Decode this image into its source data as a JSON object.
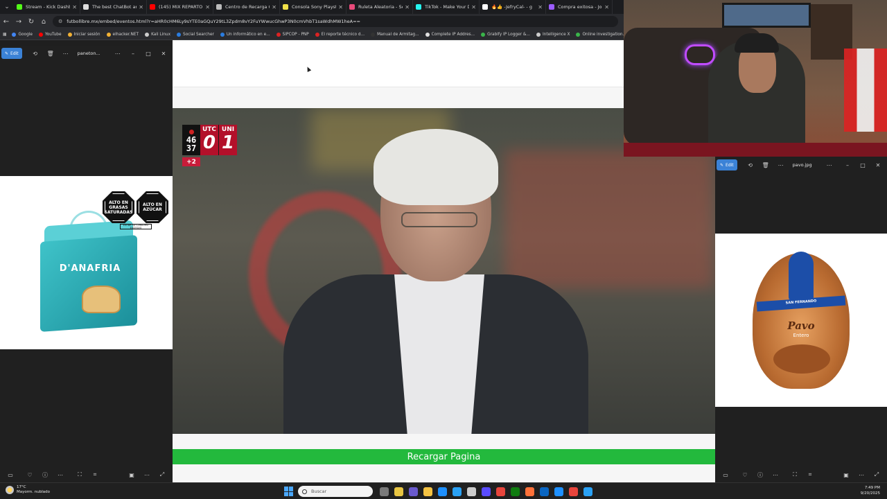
{
  "browser": {
    "tabs": [
      {
        "title": "Stream - Kick Dashboard",
        "color": "#53fc18"
      },
      {
        "title": "The best ChatBot and",
        "color": "#dddddd"
      },
      {
        "title": "(145) MIX REPARTO 20",
        "color": "#ff0000"
      },
      {
        "title": "Centro de Recarga Ga",
        "color": "#bbbbbb"
      },
      {
        "title": "Consola Sony Playstati",
        "color": "#f0e048"
      },
      {
        "title": "Ruleta Aleatoria - Sele",
        "color": "#e84a7a"
      },
      {
        "title": "TikTok - Make Your Da",
        "color": "#25f4ee"
      },
      {
        "title": "🔥👍 -JefryCal- - g",
        "color": "#ffffff"
      },
      {
        "title": "Compra exitosa - Jorg",
        "color": "#9b5cff"
      }
    ],
    "url": "futbollibre.mx/embed/eventos.html?r=aHR0cHM6Ly9sYTE0aGQuY29tL3Zpdm8vY2FuYWwucGhwP3N0cmVhbT1saWdhMW1heA==",
    "bookmarks": [
      {
        "label": "Google",
        "color": "#4285f4"
      },
      {
        "label": "YouTube",
        "color": "#ff0000"
      },
      {
        "label": "Iniciar sesión",
        "color": "#f2b134"
      },
      {
        "label": "elhacker.NET",
        "color": "#f2b134"
      },
      {
        "label": "Kali Linux",
        "color": "#cccccc"
      },
      {
        "label": "Social Searcher",
        "color": "#2a7de1"
      },
      {
        "label": "Un informático en e...",
        "color": "#2a7de1"
      },
      {
        "label": "SIPCOP - PNP",
        "color": "#d22"
      },
      {
        "label": "El reporte técnico d...",
        "color": "#d22"
      },
      {
        "label": "Manual de Armitag...",
        "color": "#333333"
      },
      {
        "label": "Complete IP Addres...",
        "color": "#e0e0e0"
      },
      {
        "label": "Grabify IP Logger &...",
        "color": "#3ab54a"
      },
      {
        "label": "Intelligence X",
        "color": "#cccccc"
      },
      {
        "label": "Online investigation...",
        "color": "#3ab54a"
      }
    ]
  },
  "webpage": {
    "scoreboard": {
      "minute": "46",
      "second": "37",
      "home_team": "UTC",
      "home_score": "0",
      "away_team": "UNI",
      "away_score": "1",
      "added_time": "+2"
    },
    "reload_button": "Recargar Pagina"
  },
  "viewer_left": {
    "edit_label": "Edit",
    "title": "paneton...",
    "image": {
      "brand": "D'ANAFRIA",
      "warning_1": "ALTO EN GRASAS SATURADAS",
      "warning_2": "ALTO EN AZÚCAR",
      "warning_note": "EVITAR SU CONSUMO EXCESIVO"
    }
  },
  "viewer_right": {
    "edit_label": "Edit",
    "title": "pavo.jpg",
    "image": {
      "brand": "SAN FERNANDO",
      "product": "Pavo",
      "subtitle": "Entero"
    }
  },
  "taskbar": {
    "temperature": "17°C",
    "weather_desc": "Mayorm. nublado",
    "search_placeholder": "Buscar",
    "time": "7:49 PM",
    "date": "9/20/2025",
    "apps": [
      "#7a7a7a",
      "#e8c542",
      "#6a5acd",
      "#f4c242",
      "#1e90ff",
      "#2aa1f4",
      "#cccccc",
      "#5a4cff",
      "#e8453c",
      "#107c10",
      "#ff7139",
      "#0a66c2",
      "#1e90ff",
      "#e8453c",
      "#2aa1f4"
    ]
  }
}
